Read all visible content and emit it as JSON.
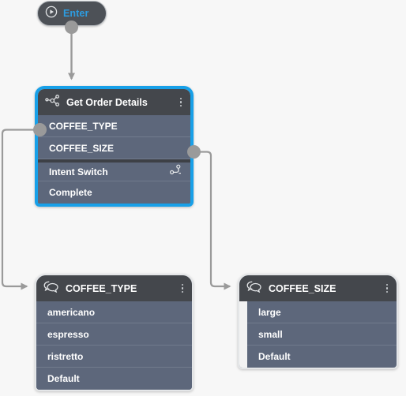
{
  "canvas": {
    "background_color": "#f7f7f7",
    "edge_color": "#9a9a9a",
    "accent_color": "#18a0e8",
    "header_color": "#44474c",
    "row_color": "#5d677b"
  },
  "enter_node": {
    "label": "Enter",
    "icon": "play-circle-icon",
    "label_color": "#2d9ce0"
  },
  "nodes": [
    {
      "id": "get-order-details",
      "title": "Get Order Details",
      "icon": "node-graph-icon",
      "menu_icon": "kebab-menu-icon",
      "selected": true,
      "rows": [
        {
          "label": "COFFEE_TYPE",
          "icon": ""
        },
        {
          "label": "COFFEE_SIZE",
          "icon": ""
        },
        {
          "label": "Intent Switch",
          "icon": "branch-icon"
        },
        {
          "label": "Complete",
          "icon": ""
        }
      ]
    },
    {
      "id": "coffee-type",
      "title": "COFFEE_TYPE",
      "icon": "speech-bubbles-icon",
      "menu_icon": "kebab-menu-icon",
      "selected": false,
      "rows": [
        {
          "label": "americano"
        },
        {
          "label": "espresso"
        },
        {
          "label": "ristretto"
        },
        {
          "label": "Default"
        }
      ]
    },
    {
      "id": "coffee-size",
      "title": "COFFEE_SIZE",
      "icon": "speech-bubbles-icon",
      "menu_icon": "kebab-menu-icon",
      "selected": false,
      "rows": [
        {
          "label": "large"
        },
        {
          "label": "small"
        },
        {
          "label": "Default"
        }
      ]
    }
  ],
  "ports": [
    {
      "name": "enter-output-port"
    },
    {
      "name": "coffee-type-output-port"
    },
    {
      "name": "coffee-size-output-port"
    }
  ],
  "edges": [
    {
      "from": "enter-output-port",
      "to": "get-order-details"
    },
    {
      "from": "coffee-type-output-port",
      "to": "coffee-type"
    },
    {
      "from": "coffee-size-output-port",
      "to": "coffee-size"
    }
  ]
}
